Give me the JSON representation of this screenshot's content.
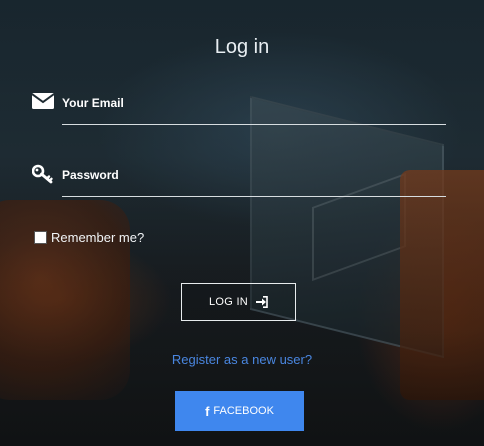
{
  "form": {
    "title": "Log in",
    "email": {
      "label": "Your Email",
      "value": "",
      "icon": "envelope-icon"
    },
    "password": {
      "label": "Password",
      "value": "",
      "icon": "key-icon"
    },
    "remember": {
      "label": "Remember me?",
      "checked": false
    },
    "login_button": {
      "label": "LOG IN",
      "icon": "sign-in-icon"
    },
    "register_link": "Register as a new user?",
    "facebook_button": {
      "label": "FACEBOOK",
      "icon_glyph": "f",
      "color": "#3f87ee"
    }
  },
  "colors": {
    "link": "#4a86e0",
    "text": "#ffffff"
  }
}
